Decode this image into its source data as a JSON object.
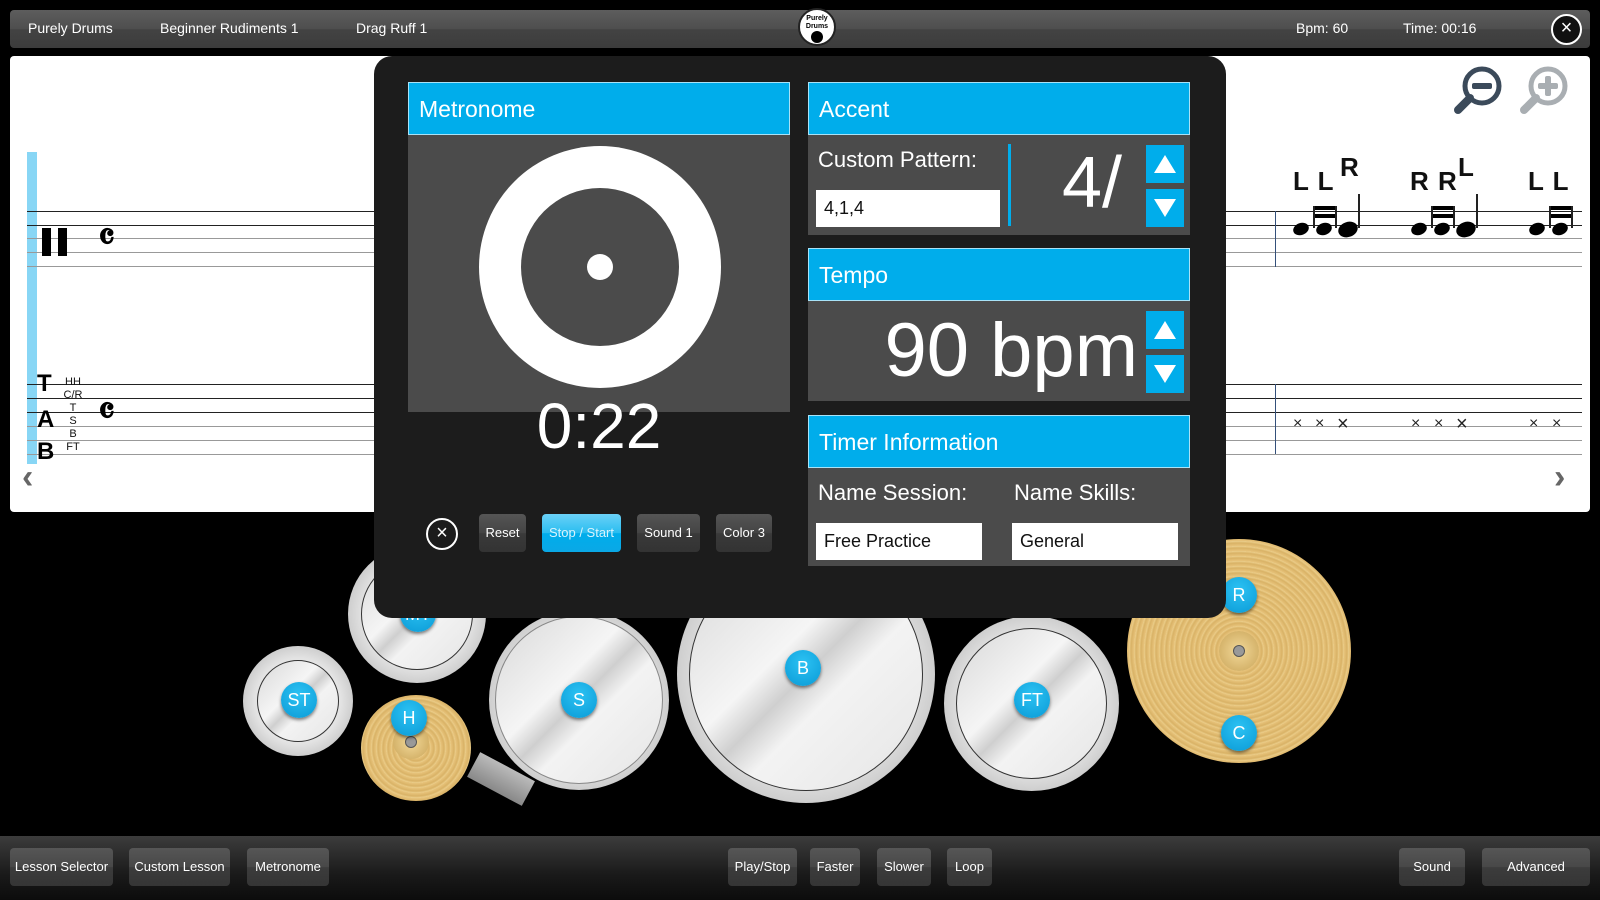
{
  "topbar": {
    "app_name": "Purely Drums",
    "lesson_group": "Beginner Rudiments 1",
    "lesson": "Drag Ruff 1",
    "logo_text": "Purely Drums",
    "bpm": "Bpm: 60",
    "time": "Time: 00:16",
    "close_icon": "×"
  },
  "sheet": {
    "common_time_symbol": "𝄴",
    "tab_letters": [
      "T",
      "A",
      "B"
    ],
    "tab_legend": [
      "HH",
      "C/R",
      "T",
      "S",
      "B",
      "FT"
    ],
    "stickings": [
      {
        "grace": "L L",
        "main": "R"
      },
      {
        "grace": "R R",
        "main": "L"
      },
      {
        "grace": "L L",
        "main": ""
      }
    ],
    "x_note": "×",
    "prev_arrow": "‹",
    "next_arrow": "›"
  },
  "metronome": {
    "title": "Metronome",
    "timer": "0:22",
    "accent": {
      "title": "Accent",
      "custom_pattern_label": "Custom Pattern:",
      "custom_pattern_value": "4,1,4",
      "time_signature": "4/"
    },
    "tempo": {
      "title": "Tempo",
      "value": "90",
      "unit": "bpm"
    },
    "timer_info": {
      "title": "Timer Information",
      "session_label": "Name Session:",
      "session_value": "Free Practice",
      "skills_label": "Name Skills:",
      "skills_value": "General"
    },
    "buttons": {
      "close": "×",
      "reset": "Reset",
      "stop_start": "Stop / Start",
      "sound": "Sound 1",
      "color": "Color 3"
    }
  },
  "kit": {
    "pads": [
      "ST",
      "MT",
      "H",
      "S",
      "B",
      "FT",
      "R",
      "C"
    ]
  },
  "bottombar": {
    "lesson_selector": "Lesson Selector",
    "custom_lesson": "Custom Lesson",
    "metronome": "Metronome",
    "play_stop": "Play/Stop",
    "faster": "Faster",
    "slower": "Slower",
    "loop": "Loop",
    "sound": "Sound",
    "advanced": "Advanced"
  },
  "colors": {
    "accent": "#00adeb",
    "panel": "#4b4b4b",
    "playhead": "#88d6f5",
    "cymbal": "#e8c47c"
  }
}
